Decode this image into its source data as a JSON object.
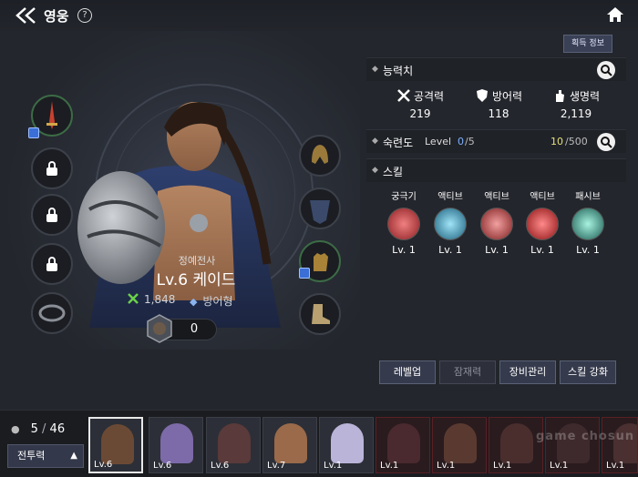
{
  "header": {
    "title": "영웅",
    "help": "?"
  },
  "hero": {
    "class": "정예전사",
    "name": "Lv.6 케이드",
    "power": "1,848",
    "type": "방어형",
    "count": "0"
  },
  "info_button": "획득 정보",
  "stats_section": {
    "label": "능력치",
    "items": [
      {
        "name": "공격력",
        "value": "219"
      },
      {
        "name": "방어력",
        "value": "118"
      },
      {
        "name": "생명력",
        "value": "2,119"
      }
    ]
  },
  "mastery": {
    "label": "숙련도",
    "level_label": "Level",
    "level_current": "0",
    "level_max": "/5",
    "xp_current": "10",
    "xp_max": "/500"
  },
  "skills": {
    "label": "스킬",
    "items": [
      {
        "type": "궁극기",
        "level": "Lv. 1",
        "color": "#d6373d"
      },
      {
        "type": "액티브",
        "level": "Lv. 1",
        "color": "#2a8fb5"
      },
      {
        "type": "액티브",
        "level": "Lv. 1",
        "color": "#b83a3a"
      },
      {
        "type": "액티브",
        "level": "Lv. 1",
        "color": "#c22d2f"
      },
      {
        "type": "패시브",
        "level": "Lv. 1",
        "color": "#2b8a7a"
      }
    ]
  },
  "actions": [
    "레벨업",
    "잠재력",
    "장비관리",
    "스킬 강화"
  ],
  "roster": {
    "count_current": "5",
    "count_total": "46",
    "sort_label": "전투력",
    "cards": [
      {
        "level": "Lv.6",
        "locked": false,
        "selected": true
      },
      {
        "level": "Lv.6",
        "locked": false,
        "selected": false
      },
      {
        "level": "Lv.6",
        "locked": false,
        "selected": false
      },
      {
        "level": "Lv.7",
        "locked": false,
        "selected": false
      },
      {
        "level": "Lv.1",
        "locked": false,
        "selected": false
      },
      {
        "level": "Lv.1",
        "locked": true,
        "selected": false
      },
      {
        "level": "Lv.1",
        "locked": true,
        "selected": false
      },
      {
        "level": "Lv.1",
        "locked": true,
        "selected": false
      },
      {
        "level": "Lv.1",
        "locked": true,
        "selected": false
      },
      {
        "level": "Lv.1",
        "locked": true,
        "selected": false
      }
    ]
  },
  "watermark": "game chosun"
}
